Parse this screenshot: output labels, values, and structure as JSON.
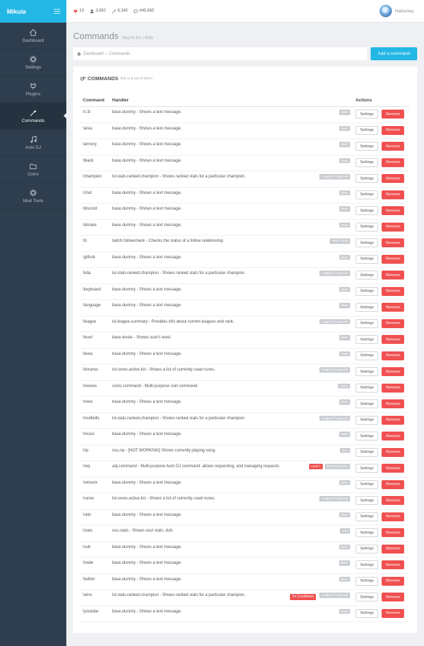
{
  "app": {
    "brand": "Mikuia"
  },
  "sidebar": {
    "items": [
      {
        "label": "Dashboard",
        "icon": "home-icon"
      },
      {
        "label": "Settings",
        "icon": "gear-icon"
      },
      {
        "label": "Plugins",
        "icon": "plug-icon"
      },
      {
        "label": "Commands",
        "icon": "wrench-icon",
        "active": true
      },
      {
        "label": "Auto DJ",
        "icon": "music-icon"
      },
      {
        "label": "Coins",
        "icon": "folder-icon"
      },
      {
        "label": "Mod Tools",
        "icon": "gear-icon"
      }
    ]
  },
  "topbar": {
    "stats": [
      {
        "icon": "heart-icon",
        "value": "19",
        "color": "#f05050"
      },
      {
        "icon": "users-icon",
        "value": "3,892"
      },
      {
        "icon": "wrench-icon",
        "value": "8,345"
      },
      {
        "icon": "comment-icon",
        "value": "445,665"
      }
    ],
    "username": "Hatsuney"
  },
  "page": {
    "title": "Commands",
    "subtitle": "they're fun i think"
  },
  "breadcrumb": {
    "items": [
      "Dashboard",
      "Commands"
    ]
  },
  "add_button": "Add a command",
  "panel": {
    "title": "COMMANDS",
    "subtitle": "this is a list of them"
  },
  "table": {
    "headers": {
      "command": "Command",
      "handler": "Handler",
      "actions": "Actions"
    },
    "settings_label": "Settings",
    "remove_label": "Remove",
    "rows": [
      {
        "command": "!c:3/",
        "handler": "base.dummy - Shows a text message.",
        "labels": [
          "Base"
        ]
      },
      {
        "command": "!area",
        "handler": "base.dummy - Shows a text message.",
        "labels": [
          "Base"
        ]
      },
      {
        "command": "!armory",
        "handler": "base.dummy - Shows a text message.",
        "labels": [
          "Base"
        ]
      },
      {
        "command": "!black",
        "handler": "base.dummy - Shows a text message.",
        "labels": [
          "Base"
        ]
      },
      {
        "command": "!champion",
        "handler": "lol.stats.ranked.champion - Shows ranked stats for a particular champion.",
        "labels": [
          "League of Legends"
        ]
      },
      {
        "command": "!chat",
        "handler": "base.dummy - Shows a text message.",
        "labels": [
          "Base"
        ]
      },
      {
        "command": "!discord",
        "handler": "base.dummy - Shows a text message.",
        "labels": [
          "Base"
        ]
      },
      {
        "command": "!donate",
        "handler": "base.dummy - Shows a text message.",
        "labels": [
          "Base"
        ]
      },
      {
        "command": "!fc",
        "handler": "twitch.followcheck - Checks the status of a follow relationship.",
        "labels": [
          "Twitch Tools"
        ]
      },
      {
        "command": "!github",
        "handler": "base.dummy - Shows a text message.",
        "labels": [
          "Base"
        ]
      },
      {
        "command": "!kda",
        "handler": "lol.stats.ranked.champion - Shows ranked stats for a particular champion.",
        "labels": [
          "League of Legends"
        ]
      },
      {
        "command": "!keyboard",
        "handler": "base.dummy - Shows a text message.",
        "labels": [
          "Base"
        ]
      },
      {
        "command": "!language",
        "handler": "base.dummy - Shows a text message.",
        "labels": [
          "Base"
        ]
      },
      {
        "command": "!league",
        "handler": "lol.league.summary - Provides info about current leagues and rank.",
        "labels": [
          "League of Legends"
        ]
      },
      {
        "command": "!level",
        "handler": "base.levels - Shows user's level.",
        "labels": [
          "Base"
        ]
      },
      {
        "command": "!lewa",
        "handler": "base.dummy - Shows a text message.",
        "labels": [
          "Base"
        ]
      },
      {
        "command": "!lolrunes",
        "handler": "lol.runes.active.list - Shows a list of currently used runes.",
        "labels": [
          "League of Legends"
        ]
      },
      {
        "command": "!meows",
        "handler": "coins.command - Multi-purpose coin command.",
        "labels": [
          "Coins"
        ]
      },
      {
        "command": "!mew",
        "handler": "base.dummy - Shows a text message.",
        "labels": [
          "Base"
        ]
      },
      {
        "command": "!multikills",
        "handler": "lol.stats.ranked.champion - Shows ranked stats for a particular champion.",
        "labels": [
          "League of Legends"
        ]
      },
      {
        "command": "!music",
        "handler": "base.dummy - Shows a text message.",
        "labels": [
          "Base"
        ]
      },
      {
        "command": "!np",
        "handler": "osu.np - [NOT WORKING] Shows currently playing song.",
        "labels": [
          "osu!"
        ]
      },
      {
        "command": "!req",
        "handler": "adj.command - Multi-purpose Auto DJ command: allows requesting, and managing requests.",
        "labels": [
          "Level 1",
          "[BETA] Auto DJ"
        ]
      },
      {
        "command": "!retronix",
        "handler": "base.dummy - Shows a text message.",
        "labels": [
          "Base"
        ]
      },
      {
        "command": "!runes",
        "handler": "lol.runes.active.list - Shows a list of currently used runes.",
        "labels": [
          "League of Legends"
        ]
      },
      {
        "command": "!skin",
        "handler": "base.dummy - Shows a text message.",
        "labels": [
          "Base"
        ]
      },
      {
        "command": "!stats",
        "handler": "osu.stats - Shows osu! stats. duh.",
        "labels": [
          "osu!"
        ]
      },
      {
        "command": "!sub",
        "handler": "base.dummy - Shows a text message.",
        "labels": [
          "Base"
        ]
      },
      {
        "command": "!trade",
        "handler": "base.dummy - Shows a text message.",
        "labels": [
          "Base"
        ]
      },
      {
        "command": "!twitter",
        "handler": "base.dummy - Shows a text message.",
        "labels": [
          "Base"
        ]
      },
      {
        "command": "!wins",
        "handler": "lol.stats.ranked.champion - Shows ranked stats for a particular champion.",
        "labels": [
          "League of Legends"
        ],
        "cooldown": "2s Cooldown"
      },
      {
        "command": "!youtube",
        "handler": "base.dummy - Shows a text message.",
        "labels": [
          "Base"
        ]
      }
    ]
  },
  "colors": {
    "accent": "#23b7e5",
    "sidebar": "#2e3e4e",
    "danger": "#f05050"
  }
}
